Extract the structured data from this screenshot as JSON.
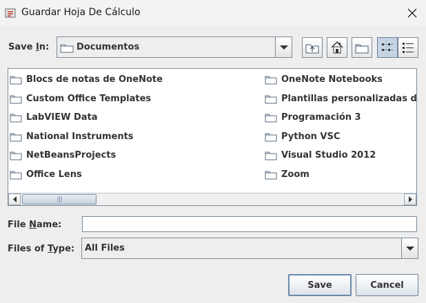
{
  "window": {
    "title": "Guardar Hoja De Cálculo"
  },
  "save_in": {
    "label_prefix": "Save ",
    "label_mnemonic": "I",
    "label_suffix": "n:",
    "value": "Documentos"
  },
  "toolbar": {
    "buttons": [
      "up-one-level",
      "home",
      "new-folder",
      "list-view",
      "details-view"
    ],
    "active": "list-view"
  },
  "files": {
    "left_column": [
      "Blocs de notas de OneNote",
      "Custom Office Templates",
      "LabVIEW Data",
      "National Instruments",
      "NetBeansProjects",
      "Office Lens"
    ],
    "right_column": [
      "OneNote Notebooks",
      "Plantillas personalizadas de",
      "Programación 3",
      "Python VSC",
      "Visual Studio 2012",
      "Zoom"
    ]
  },
  "file_name": {
    "label_prefix": "File ",
    "label_mnemonic": "N",
    "label_suffix": "ame:",
    "value": ""
  },
  "files_of_type": {
    "label_prefix": "Files of ",
    "label_mnemonic": "T",
    "label_suffix": "ype:",
    "value": "All Files"
  },
  "buttons": {
    "save": "Save",
    "cancel": "Cancel"
  },
  "colors": {
    "dialog_bg": "#eeeeee",
    "border": "#7a8a99",
    "active_toggle": "#c5d4e3",
    "folder_icon": "#5a6b7c"
  }
}
